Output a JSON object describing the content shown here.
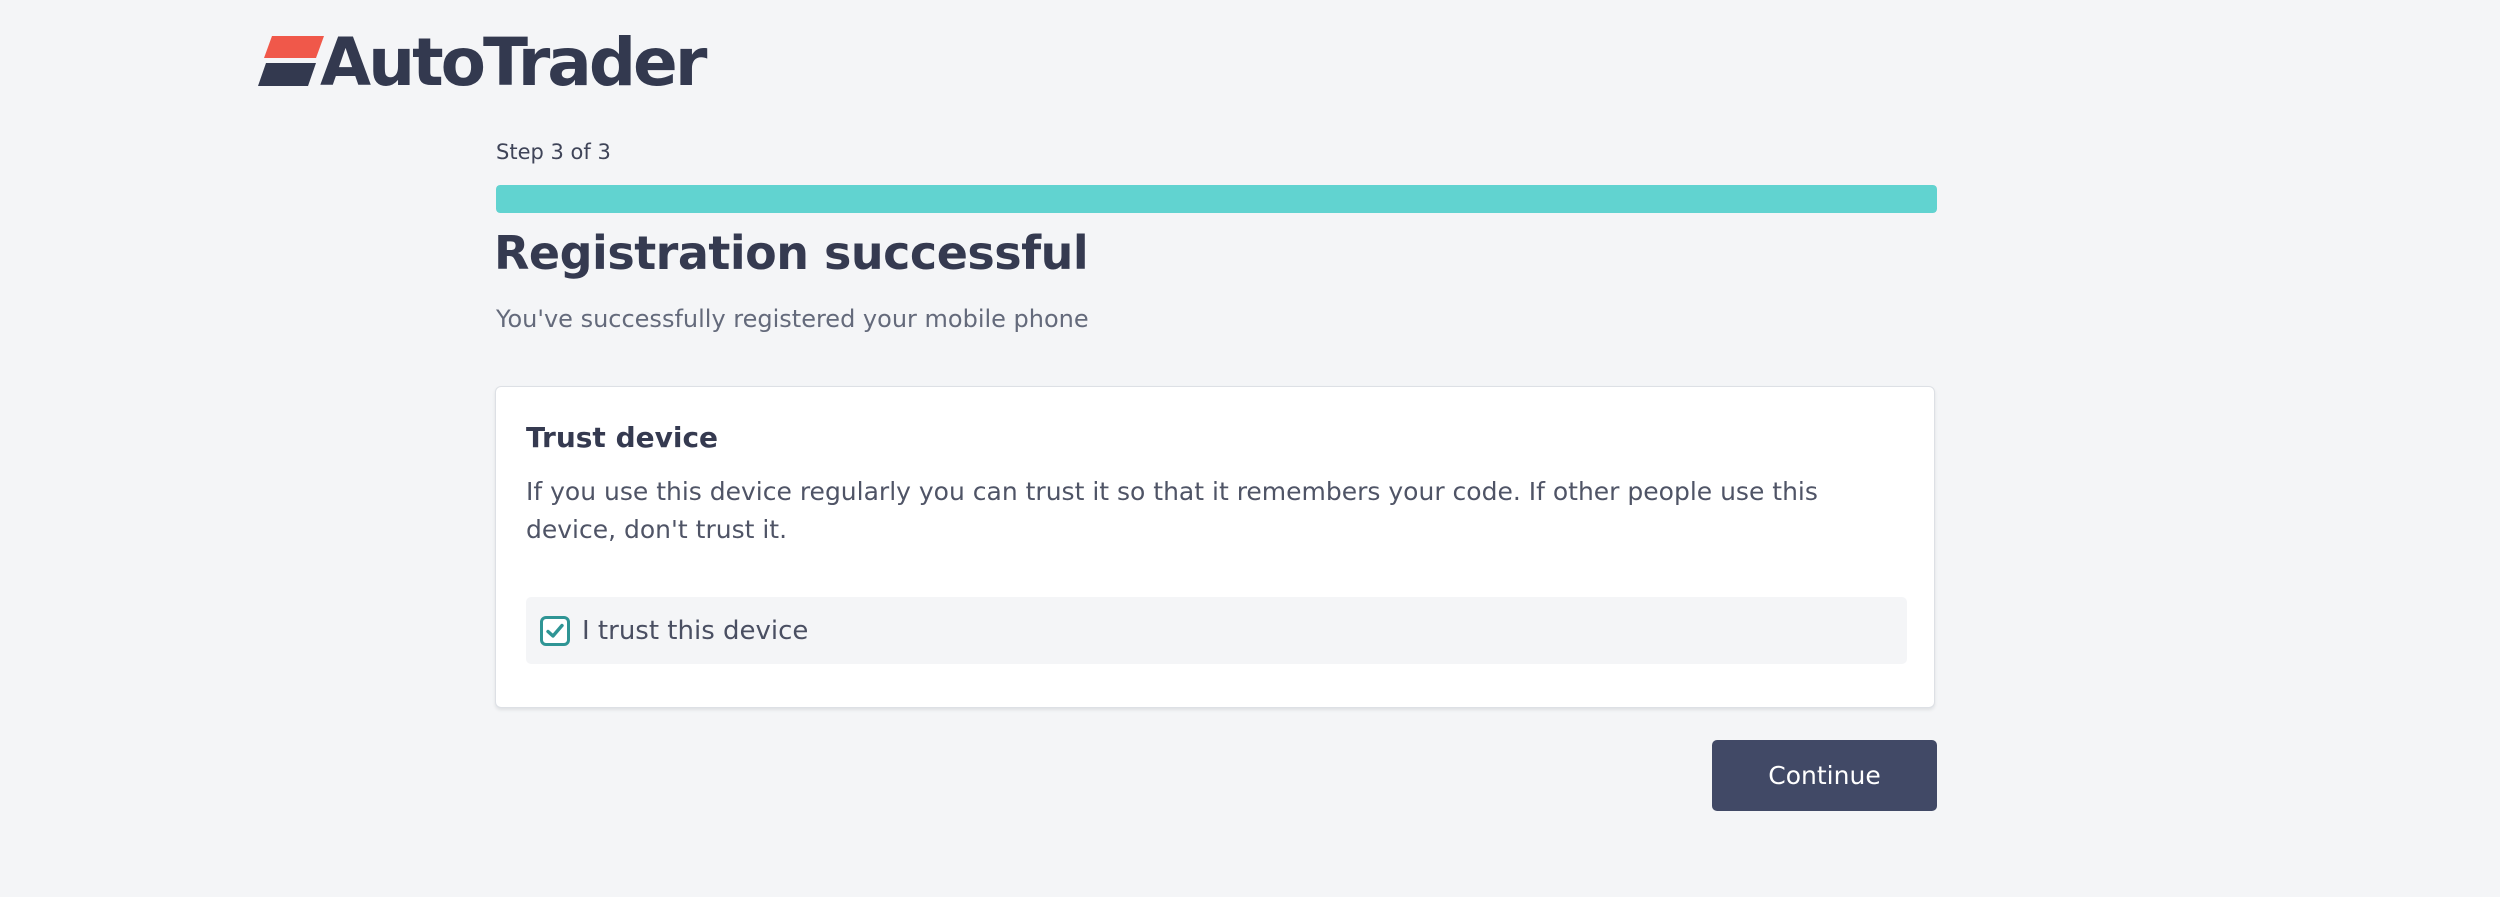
{
  "brand": {
    "name": "AutoTrader",
    "logo_icon": "autotrader-stripes-logo",
    "logo_colors": {
      "top": "#f0584a",
      "bottom": "#33394f"
    }
  },
  "progress": {
    "step_label": "Step 3 of 3",
    "current_step": 3,
    "total_steps": 3,
    "fill_fraction": 1.0,
    "fill_color": "#61d3d0"
  },
  "heading": {
    "title": "Registration successful",
    "subtitle": "You've successfully registered your mobile phone"
  },
  "trust_card": {
    "title": "Trust device",
    "description": "If you use this device regularly you can trust it so that it remembers your code. If other people use this device, don't trust it.",
    "checkbox": {
      "label": "I trust this device",
      "checked": true,
      "icon": "checkmark-icon",
      "color": "#2f9595"
    }
  },
  "actions": {
    "continue_label": "Continue",
    "button_color": "#414966"
  }
}
